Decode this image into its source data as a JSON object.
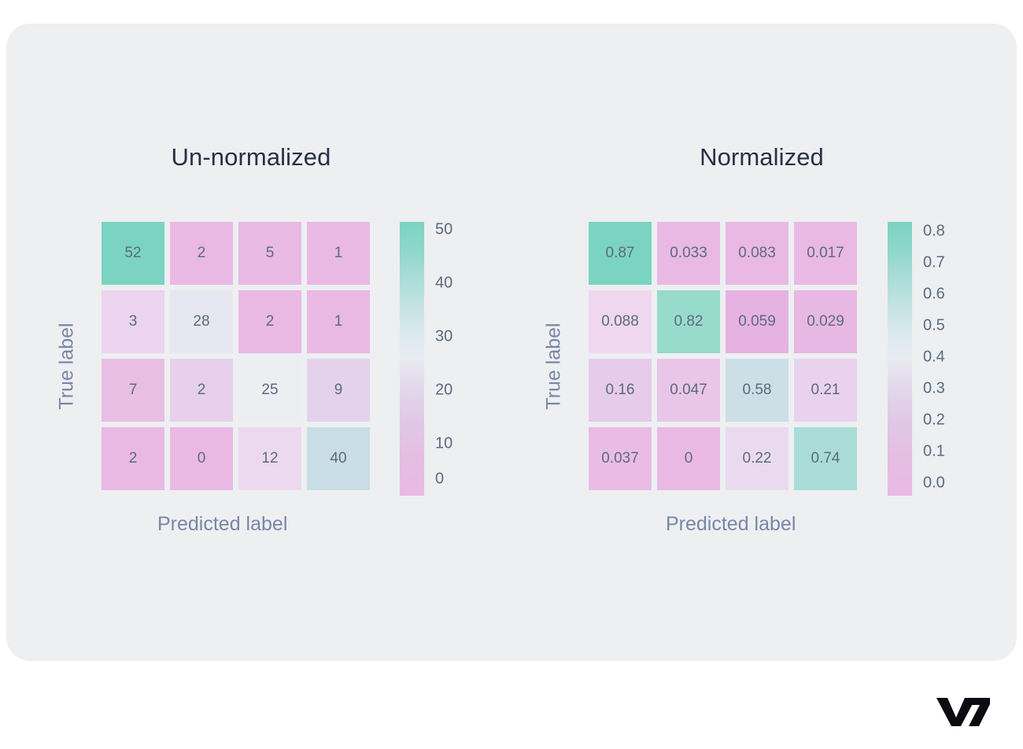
{
  "page": {
    "background_color": "#ffffff",
    "panel_color": "#edeff1"
  },
  "brand": {
    "logo_name": "v7-logo",
    "logo_text": "V7",
    "logo_color": "#0b0b12"
  },
  "colors": {
    "title_color": "#2a3045",
    "axis_label_color": "#7b85a8",
    "cell_text_color": "#5d6b7e",
    "tick_color": "#5d6b7e",
    "cmap_low": "#e9b9e4",
    "cmap_mid": "#eaeaf2",
    "cmap_high": "#7bd3c2"
  },
  "charts": [
    {
      "id": "un-normalized",
      "title": "Un-normalized",
      "xlabel": "Predicted label",
      "ylabel": "True label",
      "cells": [
        {
          "text": "52",
          "color": "#7bd3c2"
        },
        {
          "text": "2",
          "color": "#e9b9e4"
        },
        {
          "text": "5",
          "color": "#e8bae4"
        },
        {
          "text": "1",
          "color": "#e9b9e4"
        },
        {
          "text": "3",
          "color": "#ecd4ee"
        },
        {
          "text": "28",
          "color": "#e6e7f0"
        },
        {
          "text": "2",
          "color": "#e9b9e4"
        },
        {
          "text": "1",
          "color": "#e9b9e4"
        },
        {
          "text": "7",
          "color": "#e8bee5"
        },
        {
          "text": "2",
          "color": "#e6d0ea"
        },
        {
          "text": "25",
          "color": "#edeef2"
        },
        {
          "text": "9",
          "color": "#e4d2ec"
        },
        {
          "text": "2",
          "color": "#e9b9e4"
        },
        {
          "text": "0",
          "color": "#e9b9e4"
        },
        {
          "text": "12",
          "color": "#ecd9ef"
        },
        {
          "text": "40",
          "color": "#c9dde6"
        }
      ],
      "colorbar": {
        "ticks": [
          "50",
          "40",
          "30",
          "20",
          "10",
          "0"
        ],
        "positions_pct": [
          90.5,
          71.0,
          51.5,
          32.0,
          12.5,
          -0.5
        ]
      }
    },
    {
      "id": "normalized",
      "title": "Normalized",
      "xlabel": "Predicted label",
      "ylabel": "True label",
      "cells": [
        {
          "text": "0.87",
          "color": "#7bd3c2"
        },
        {
          "text": "0.033",
          "color": "#e9b9e4"
        },
        {
          "text": "0.083",
          "color": "#e9b9e4"
        },
        {
          "text": "0.017",
          "color": "#e9b9e4"
        },
        {
          "text": "0.088",
          "color": "#efd7f0"
        },
        {
          "text": "0.82",
          "color": "#97dbcc"
        },
        {
          "text": "0.059",
          "color": "#e6b2e1"
        },
        {
          "text": "0.029",
          "color": "#e7b8e3"
        },
        {
          "text": "0.16",
          "color": "#e6cbeb"
        },
        {
          "text": "0.047",
          "color": "#e9c5e9"
        },
        {
          "text": "0.58",
          "color": "#ccdfe6"
        },
        {
          "text": "0.21",
          "color": "#e9d2ee"
        },
        {
          "text": "0.037",
          "color": "#e9bbe5"
        },
        {
          "text": "0",
          "color": "#e9b9e4"
        },
        {
          "text": "0.22",
          "color": "#eadaf0"
        },
        {
          "text": "0.74",
          "color": "#a9dcd6"
        }
      ],
      "colorbar": {
        "ticks": [
          "0.8",
          "0.7",
          "0.6",
          "0.5",
          "0.4",
          "0.3",
          "0.2",
          "0.1",
          "0.0"
        ],
        "positions_pct": [
          90.0,
          78.5,
          67.0,
          55.5,
          44.0,
          32.5,
          21.0,
          9.5,
          -2.0
        ]
      }
    }
  ],
  "chart_data": [
    {
      "type": "heatmap",
      "title": "Un-normalized",
      "xlabel": "Predicted label",
      "ylabel": "True label",
      "rows": 4,
      "cols": 4,
      "values": [
        [
          52,
          2,
          5,
          1
        ],
        [
          3,
          28,
          2,
          1
        ],
        [
          7,
          2,
          25,
          9
        ],
        [
          2,
          0,
          12,
          40
        ]
      ],
      "colorbar_ticks": [
        0,
        10,
        20,
        30,
        40,
        50
      ],
      "zlim": [
        0,
        52
      ],
      "colormap": "pink-to-teal diverging (PiYG-like pastel)",
      "legend_position": "right",
      "grid": false
    },
    {
      "type": "heatmap",
      "title": "Normalized",
      "xlabel": "Predicted label",
      "ylabel": "True label",
      "rows": 4,
      "cols": 4,
      "values": [
        [
          0.87,
          0.033,
          0.083,
          0.017
        ],
        [
          0.088,
          0.82,
          0.059,
          0.029
        ],
        [
          0.16,
          0.047,
          0.58,
          0.21
        ],
        [
          0.037,
          0,
          0.22,
          0.74
        ]
      ],
      "colorbar_ticks": [
        0.0,
        0.1,
        0.2,
        0.3,
        0.4,
        0.5,
        0.6,
        0.7,
        0.8
      ],
      "zlim": [
        0,
        0.87
      ],
      "colormap": "pink-to-teal diverging (PiYG-like pastel)",
      "legend_position": "right",
      "grid": false
    }
  ]
}
